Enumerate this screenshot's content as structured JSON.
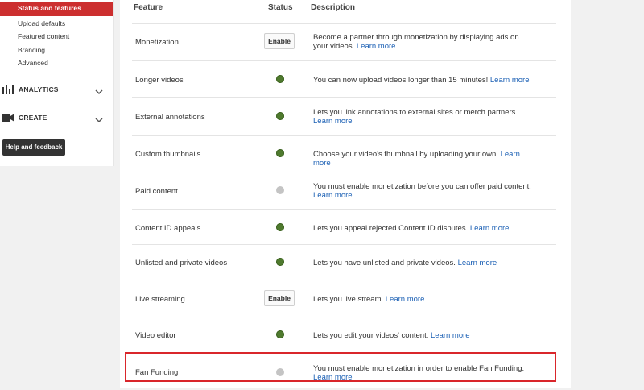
{
  "sidebar": {
    "active_item": "Status and features",
    "sub_items": [
      "Upload defaults",
      "Featured content",
      "Branding",
      "Advanced"
    ],
    "sections": [
      {
        "label": "ANALYTICS",
        "icon": "bar-chart-icon"
      },
      {
        "label": "CREATE",
        "icon": "video-camera-icon"
      }
    ],
    "help_button": "Help and feedback"
  },
  "table": {
    "headers": {
      "feature": "Feature",
      "status": "Status",
      "description": "Description"
    },
    "rows": [
      {
        "feature": "Monetization",
        "status": "button",
        "button_label": "Enable",
        "desc": "Become a partner through monetization by displaying ads on your videos.",
        "link": "Learn more"
      },
      {
        "feature": "Longer videos",
        "status": "on",
        "desc": "You can now upload videos longer than 15 minutes!",
        "link": "Learn more"
      },
      {
        "feature": "External annotations",
        "status": "on",
        "desc": "Lets you link annotations to external sites or merch partners.",
        "link": "Learn more"
      },
      {
        "feature": "Custom thumbnails",
        "status": "on",
        "desc": "Choose your video's thumbnail by uploading your own.",
        "link": "Learn more"
      },
      {
        "feature": "Paid content",
        "status": "off",
        "desc": "You must enable monetization before you can offer paid content.",
        "link": "Learn more"
      },
      {
        "feature": "Content ID appeals",
        "status": "on",
        "desc": "Lets you appeal rejected Content ID disputes.",
        "link": "Learn more"
      },
      {
        "feature": "Unlisted and private videos",
        "status": "on",
        "desc": "Lets you have unlisted and private videos.",
        "link": "Learn more"
      },
      {
        "feature": "Live streaming",
        "status": "button",
        "button_label": "Enable",
        "desc": "Lets you live stream.",
        "link": "Learn more"
      },
      {
        "feature": "Video editor",
        "status": "on",
        "desc": "Lets you edit your videos' content.",
        "link": "Learn more"
      },
      {
        "feature": "Fan Funding",
        "status": "off",
        "desc": "You must enable monetization in order to enable Fan Funding.",
        "link": "Learn more"
      }
    ]
  },
  "colors": {
    "accent": "#cc2f2f",
    "status_on": "#4f7a2e",
    "status_off": "#c4c4c4",
    "link": "#1a5fb4",
    "highlight": "#d9262b"
  }
}
